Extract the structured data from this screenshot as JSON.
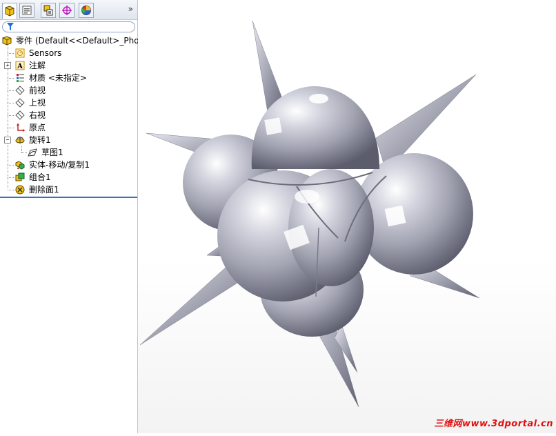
{
  "tabs": [
    {
      "icon": "feature-manager-icon",
      "active": true
    },
    {
      "icon": "property-manager-icon"
    },
    {
      "icon": "configuration-manager-icon"
    },
    {
      "icon": "dimxpert-icon"
    },
    {
      "icon": "display-manager-icon"
    }
  ],
  "expand_label": "»",
  "tree": {
    "root": "零件  (Default<<Default>_Phot",
    "items": [
      {
        "label": "Sensors",
        "icon": "sensors-icon"
      },
      {
        "label": "注解",
        "icon": "annotations-icon"
      },
      {
        "label": "材质 <未指定>",
        "icon": "material-icon"
      },
      {
        "label": "前视",
        "icon": "plane-icon"
      },
      {
        "label": "上视",
        "icon": "plane-icon"
      },
      {
        "label": "右视",
        "icon": "plane-icon"
      },
      {
        "label": "原点",
        "icon": "origin-icon"
      },
      {
        "label": "旋转1",
        "icon": "revolve-icon"
      },
      {
        "label": "草图1",
        "icon": "sketch-icon"
      },
      {
        "label": "实体-移动/复制1",
        "icon": "move-copy-icon"
      },
      {
        "label": "组合1",
        "icon": "combine-icon"
      },
      {
        "label": "删除面1",
        "icon": "delete-face-icon"
      }
    ]
  },
  "watermark": "三维网www.3dportal.cn",
  "colors": {
    "accent": "#3a6fc4",
    "watermark": "#e01010",
    "model": "#a9aab6"
  }
}
